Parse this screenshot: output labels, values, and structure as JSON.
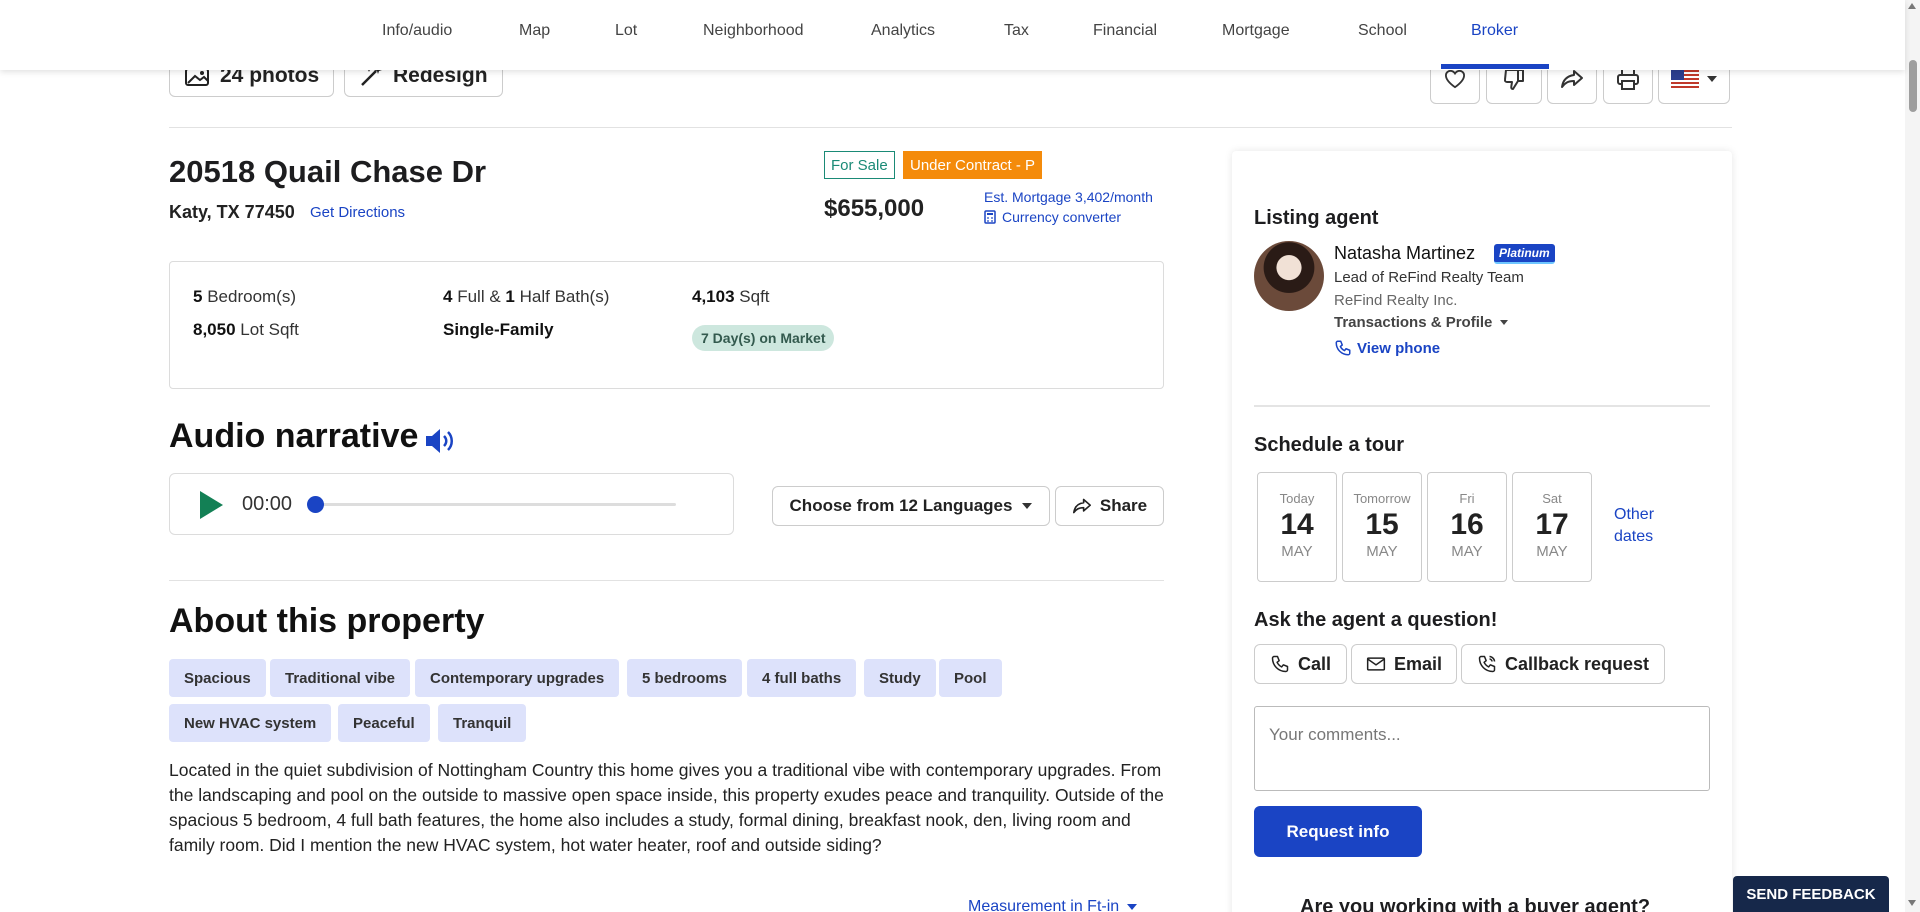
{
  "nav": {
    "tabs": [
      "Info/audio",
      "Map",
      "Lot",
      "Neighborhood",
      "Analytics",
      "Tax",
      "Financial",
      "Mortgage",
      "School",
      "Broker"
    ],
    "active": "Broker"
  },
  "photos": {
    "photos_label": "24 photos",
    "redesign_label": "Redesign"
  },
  "listing": {
    "address": "20518 Quail Chase Dr",
    "city": "Katy, TX 77450",
    "directions": "Get Directions",
    "status_sale": "For Sale",
    "status_contract": "Under Contract - P",
    "price": "$655,000",
    "est_mortgage": "Est. Mortgage 3,402/month",
    "currency": "Currency converter"
  },
  "facts": {
    "beds_num": "5",
    "beds_label": "Bedroom(s)",
    "full_num": "4",
    "full_label": "Full &",
    "half_num": "1",
    "half_label": "Half Bath(s)",
    "sqft_num": "4,103",
    "sqft_label": "Sqft",
    "lot_num": "8,050",
    "lot_label": "Lot Sqft",
    "type": "Single-Family",
    "market": "7 Day(s) on Market"
  },
  "audio": {
    "title": "Audio narrative",
    "time": "00:00",
    "progress": 0,
    "languages": "Choose from 12 Languages",
    "share": "Share"
  },
  "about": {
    "title": "About this property",
    "chips": [
      "Spacious",
      "Traditional vibe",
      "Contemporary upgrades",
      "5 bedrooms",
      "4 full baths",
      "Study",
      "Pool",
      "New HVAC system",
      "Peaceful",
      "Tranquil"
    ],
    "description": "Located in the quiet subdivision of Nottingham Country this home gives you a traditional vibe with contemporary upgrades. From the landscaping and pool on the outside to massive open space inside, this property exudes peace and tranquility. Outside of the spacious 5 bedroom, 4 full bath features, the home also includes a study, formal dining, breakfast nook, den, living room and family room. Did I mention the new HVAC system, hot water heater, roof and outside siding?",
    "measurement": "Measurement in Ft-in"
  },
  "agent": {
    "heading": "Listing agent",
    "name": "Natasha Martinez",
    "tier": "Platinum",
    "role": "Lead of ReFind Realty Team",
    "company": "ReFind Realty Inc.",
    "transactions": "Transactions & Profile",
    "phone": "View phone"
  },
  "tour": {
    "heading": "Schedule a tour",
    "days": [
      {
        "name": "Today",
        "date": "14",
        "month": "MAY"
      },
      {
        "name": "Tomorrow",
        "date": "15",
        "month": "MAY"
      },
      {
        "name": "Fri",
        "date": "16",
        "month": "MAY"
      },
      {
        "name": "Sat",
        "date": "17",
        "month": "MAY"
      }
    ],
    "other_dates_1": "Other",
    "other_dates_2": "dates"
  },
  "ask": {
    "heading": "Ask the agent a question!",
    "call": "Call",
    "email": "Email",
    "callback": "Callback request",
    "comments_placeholder": "Your comments...",
    "request": "Request info",
    "buyer_question": "Are you working with a buyer agent?"
  },
  "feedback": "SEND FEEDBACK",
  "colors": {
    "accent": "#1a44c4",
    "contract": "#f48b0b",
    "sale": "#1a8a76",
    "chip": "#dde2fb"
  }
}
